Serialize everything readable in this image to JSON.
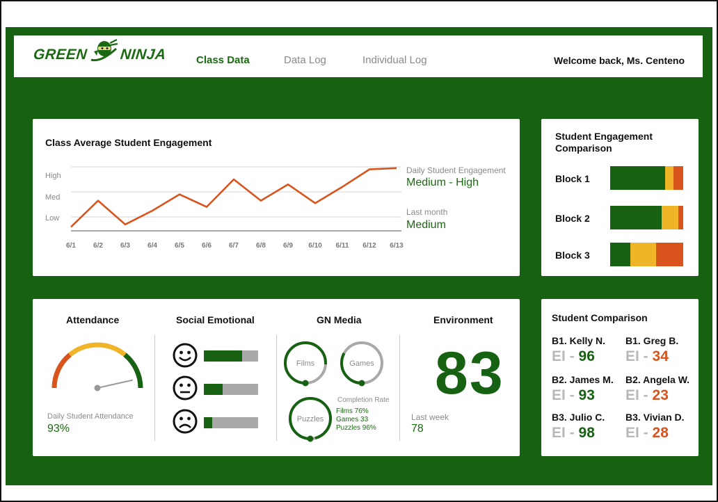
{
  "header": {
    "logo_left": "GREEN",
    "logo_right": "NINJA",
    "nav": [
      "Class Data",
      "Data Log",
      "Individual Log"
    ],
    "welcome": "Welcome back, Ms. Centeno"
  },
  "colors": {
    "brand_green": "#166112",
    "accent_orange": "#d9531c",
    "accent_yellow": "#f0b428",
    "muted_grey": "#a9a9a9"
  },
  "engagement": {
    "title": "Class Average Student Engagement",
    "daily_label": "Daily Student Engagement",
    "daily_value": "Medium - High",
    "month_label": "Last month",
    "month_value": "Medium"
  },
  "chart_data": {
    "type": "line",
    "title": "Class Average Student Engagement",
    "y_tick_labels": [
      "Low",
      "Med",
      "High"
    ],
    "ylim": [
      0,
      3
    ],
    "x": [
      "6/1",
      "6/2",
      "6/3",
      "6/4",
      "6/5",
      "6/6",
      "6/7",
      "6/8",
      "6/9",
      "6/10",
      "6/11",
      "6/12",
      "6/13"
    ],
    "series": [
      {
        "values": [
          0.6,
          1.65,
          0.7,
          1.25,
          1.9,
          1.4,
          2.5,
          1.65,
          2.3,
          1.55,
          2.2,
          2.9,
          2.95
        ],
        "color": "#d9531c"
      }
    ],
    "grid": true
  },
  "block_comparison": {
    "title": "Student Engagement Comparison",
    "blocks": [
      {
        "label": "Block 1",
        "high": 0.75,
        "mid": 0.12,
        "low": 0.13
      },
      {
        "label": "Block 2",
        "high": 0.7,
        "mid": 0.23,
        "low": 0.07
      },
      {
        "label": "Block 3",
        "high": 0.28,
        "mid": 0.35,
        "low": 0.37
      }
    ]
  },
  "metrics": {
    "attendance": {
      "title": "Attendance",
      "label": "Daily Student Attendance",
      "value": "93%",
      "gauge_fraction": 0.93
    },
    "social_emotional": {
      "title": "Social Emotional",
      "rows": [
        {
          "icon": "smiling-face-icon",
          "fraction": 0.7
        },
        {
          "icon": "neutral-face-icon",
          "fraction": 0.34
        },
        {
          "icon": "sad-face-icon",
          "fraction": 0.15
        }
      ]
    },
    "gn_media": {
      "title": "GN Media",
      "rings": [
        {
          "label": "Films",
          "fraction": 0.76
        },
        {
          "label": "Games",
          "fraction": 0.33
        },
        {
          "label": "Puzzles",
          "fraction": 0.96
        }
      ],
      "completion_title": "Completion Rate",
      "completion_lines": [
        "Films 76%",
        "Games 33",
        "Puzzles 96%"
      ]
    },
    "environment": {
      "title": "Environment",
      "value": "83",
      "last_week_label": "Last week",
      "last_week_value": "78"
    }
  },
  "student_comparison": {
    "title": "Student Comparison",
    "ei_label": "EI",
    "students": [
      {
        "name": "B1. Kelly N.",
        "score": "96",
        "status": "good"
      },
      {
        "name": "B1. Greg B.",
        "score": "34",
        "status": "bad"
      },
      {
        "name": "B2. James M.",
        "score": "93",
        "status": "good"
      },
      {
        "name": "B2. Angela W.",
        "score": "23",
        "status": "bad"
      },
      {
        "name": "B3. Julio C.",
        "score": "98",
        "status": "good"
      },
      {
        "name": "B3. Vivian D.",
        "score": "28",
        "status": "bad"
      }
    ]
  }
}
